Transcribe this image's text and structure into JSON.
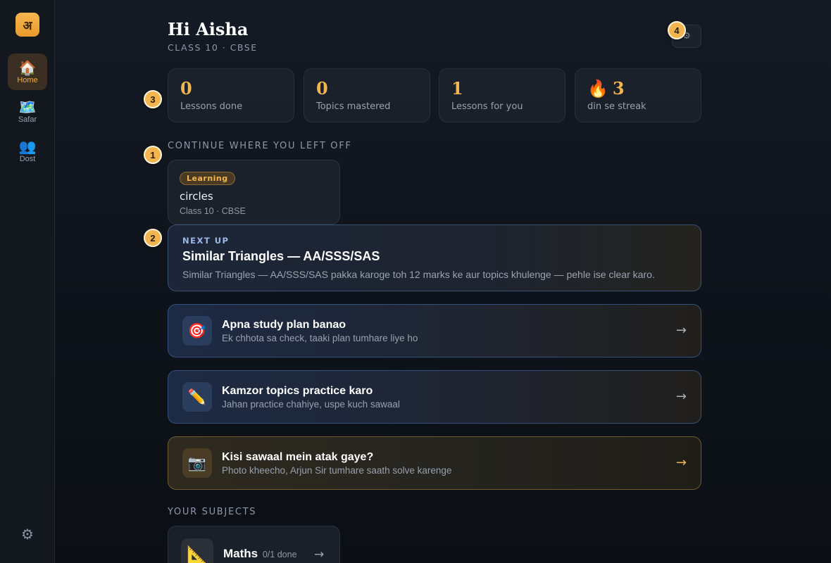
{
  "sidebar": {
    "logo": "अ",
    "items": [
      {
        "icon": "🏠",
        "icon_name": "home-icon",
        "label": "Home",
        "active": true
      },
      {
        "icon": "🗺️",
        "icon_name": "map-icon",
        "label": "Safar"
      },
      {
        "icon": "👥",
        "icon_name": "people-icon",
        "label": "Dost"
      }
    ],
    "settings_icon": "⚙"
  },
  "header": {
    "greeting": "Hi Aisha",
    "subtitle": "CLASS 10 · CBSE",
    "settings_icon": "⚙"
  },
  "badges": [
    "1",
    "2",
    "3",
    "4"
  ],
  "stats": [
    {
      "value": "0",
      "label": "Lessons done"
    },
    {
      "value": "0",
      "label": "Topics mastered"
    },
    {
      "value": "1",
      "label": "Lessons for you"
    },
    {
      "icon": "🔥",
      "value": "3",
      "label": "din se streak"
    }
  ],
  "continue_section": {
    "label": "CONTINUE WHERE YOU LEFT OFF",
    "card": {
      "status": "Learning",
      "title": "circles",
      "meta": "Class 10 · CBSE"
    }
  },
  "next_up": {
    "kicker": "NEXT UP",
    "title": "Similar Triangles — AA/SSS/SAS",
    "description": "Similar Triangles — AA/SSS/SAS pakka karoge toh 12 marks ke aur topics khulenge — pehle ise clear karo."
  },
  "actions": [
    {
      "icon": "🎯",
      "title": "Apna study plan banao",
      "subtitle": "Ek chhota sa check, taaki plan tumhare liye ho",
      "arrow": "→"
    },
    {
      "icon": "✏️",
      "title": "Kamzor topics practice karo",
      "subtitle": "Jahan practice chahiye, uspe kuch sawaal",
      "arrow": "→"
    },
    {
      "icon": "📷",
      "title": "Kisi sawaal mein atak gaye?",
      "subtitle": "Photo kheecho, Arjun Sir tumhare saath solve karenge",
      "arrow": "→"
    }
  ],
  "subjects_section": {
    "label": "YOUR SUBJECTS",
    "items": [
      {
        "icon": "📐",
        "name": "Maths",
        "progress": "0/1 done",
        "arrow": "→"
      }
    ]
  },
  "colors": {
    "accent": "#f2b54f",
    "background": "#0f141c",
    "card_border_blue": "#3a5070",
    "card_border_amber": "#6f5a32"
  }
}
